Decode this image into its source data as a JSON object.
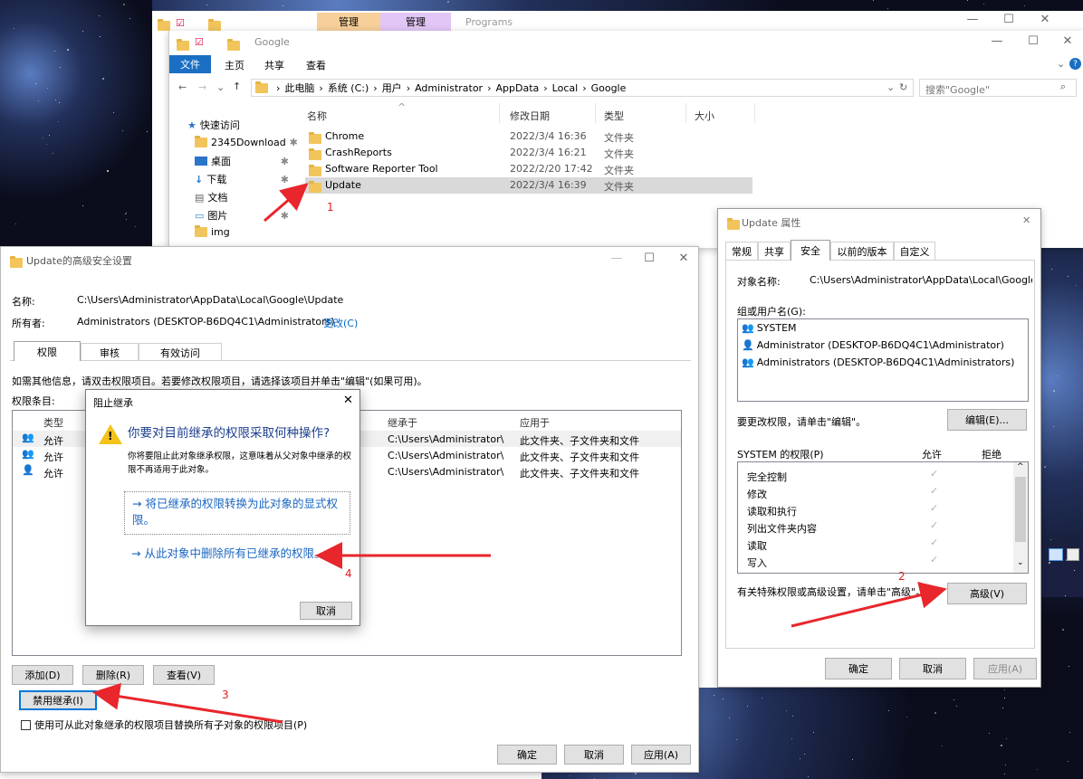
{
  "outer_window": {
    "ribbon_tabs": [
      "管理",
      "管理"
    ],
    "title": "Programs"
  },
  "explorer": {
    "title": "Google",
    "ribbon_tabs": [
      "文件",
      "主页",
      "共享",
      "查看"
    ],
    "breadcrumb": [
      "此电脑",
      "系统 (C:)",
      "用户",
      "Administrator",
      "AppData",
      "Local",
      "Google"
    ],
    "search_placeholder": "搜索\"Google\"",
    "nav": [
      {
        "label": "快速访问",
        "icon": "star-icon"
      },
      {
        "label": "2345Download",
        "icon": "folder-icon"
      },
      {
        "label": "桌面",
        "icon": "desktop-icon"
      },
      {
        "label": "下载",
        "icon": "download-icon"
      },
      {
        "label": "文档",
        "icon": "document-icon"
      },
      {
        "label": "图片",
        "icon": "picture-icon"
      },
      {
        "label": "img",
        "icon": "folder-icon"
      }
    ],
    "columns": [
      "名称",
      "修改日期",
      "类型",
      "大小"
    ],
    "files": [
      {
        "name": "Chrome",
        "date": "2022/3/4 16:36",
        "type": "文件夹"
      },
      {
        "name": "CrashReports",
        "date": "2022/3/4 16:21",
        "type": "文件夹"
      },
      {
        "name": "Software Reporter Tool",
        "date": "2022/2/20 17:42",
        "type": "文件夹"
      },
      {
        "name": "Update",
        "date": "2022/3/4 16:39",
        "type": "文件夹"
      }
    ]
  },
  "advanced": {
    "title": "Update的高级安全设置",
    "name_label": "名称:",
    "name_value": "C:\\Users\\Administrator\\AppData\\Local\\Google\\Update",
    "owner_label": "所有者:",
    "owner_value": "Administrators (DESKTOP-B6DQ4C1\\Administrators)",
    "change_link": "更改(C)",
    "tabs": [
      "权限",
      "审核",
      "有效访问"
    ],
    "info": "如需其他信息，请双击权限项目。若要修改权限项目，请选择该项目并单击\"编辑\"(如果可用)。",
    "entries_label": "权限条目:",
    "columns": [
      "类型",
      "继承于",
      "应用于"
    ],
    "rows": [
      {
        "type": "允许",
        "inherited": "C:\\Users\\Administrator\\",
        "applies": "此文件夹、子文件夹和文件"
      },
      {
        "type": "允许",
        "inherited": "C:\\Users\\Administrator\\",
        "applies": "此文件夹、子文件夹和文件"
      },
      {
        "type": "允许",
        "inherited": "C:\\Users\\Administrator\\",
        "applies": "此文件夹、子文件夹和文件"
      }
    ],
    "add": "添加(D)",
    "remove": "删除(R)",
    "view": "查看(V)",
    "disable_inheritance": "禁用继承(I)",
    "replace_checkbox": "使用可从此对象继承的权限项目替换所有子对象的权限项目(P)",
    "ok": "确定",
    "cancel": "取消",
    "apply": "应用(A)"
  },
  "block_dialog": {
    "title": "阻止继承",
    "question": "你要对目前继承的权限采取何种操作?",
    "desc": "你将要阻止此对象继承权限，这意味着从父对象中继承的权限不再适用于此对象。",
    "option1": "→ 将已继承的权限转换为此对象的显式权限。",
    "option2": "→ 从此对象中删除所有已继承的权限。",
    "cancel": "取消"
  },
  "props": {
    "title": "Update 属性",
    "tabs": [
      "常规",
      "共享",
      "安全",
      "以前的版本",
      "自定义"
    ],
    "object_label": "对象名称:",
    "object_value": "C:\\Users\\Administrator\\AppData\\Local\\Google\\U",
    "group_label": "组或用户名(G):",
    "users": [
      "SYSTEM",
      "Administrator (DESKTOP-B6DQ4C1\\Administrator)",
      "Administrators (DESKTOP-B6DQ4C1\\Administrators)"
    ],
    "edit_hint": "要更改权限，请单击\"编辑\"。",
    "edit": "编辑(E)...",
    "perm_label": "SYSTEM 的权限(P)",
    "allow": "允许",
    "deny": "拒绝",
    "perms": [
      "完全控制",
      "修改",
      "读取和执行",
      "列出文件夹内容",
      "读取",
      "写入"
    ],
    "check": "✓",
    "special_hint": "有关特殊权限或高级设置，请单击\"高级\"。",
    "advanced": "高级(V)",
    "ok": "确定",
    "cancel": "取消",
    "apply": "应用(A)"
  },
  "annotations": [
    "1",
    "2",
    "3",
    "4"
  ]
}
